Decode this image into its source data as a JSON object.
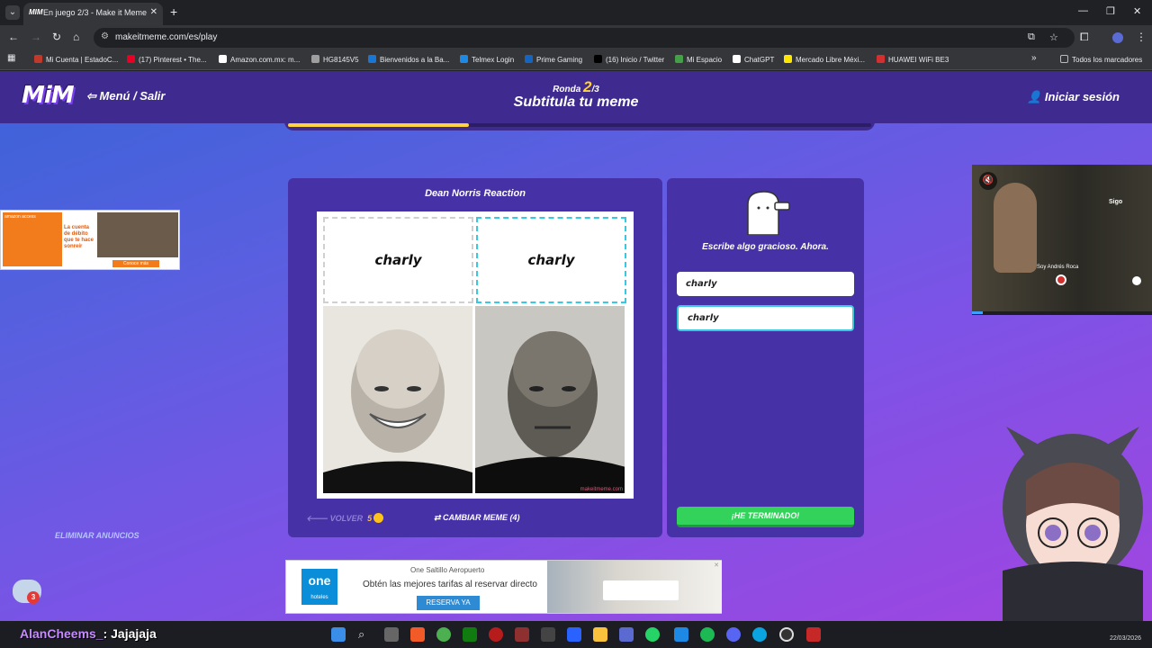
{
  "browser": {
    "tab_title": "En juego 2/3 - Make it Meme",
    "tab_favicon": "MIM",
    "url": "makeitmeme.com/es/play",
    "bookmarks": [
      {
        "label": "Mi Cuenta | EstadoC...",
        "color": "#c0392b"
      },
      {
        "label": "(17) Pinterest • The...",
        "color": "#e60023"
      },
      {
        "label": "Amazon.com.mx: m...",
        "color": "#ffffff"
      },
      {
        "label": "HG8145V5",
        "color": "#9e9e9e"
      },
      {
        "label": "Bienvenidos a la Ba...",
        "color": "#1976d2"
      },
      {
        "label": "Telmex Login",
        "color": "#1e88e5"
      },
      {
        "label": "Prime Gaming",
        "color": "#1565c0"
      },
      {
        "label": "(16) Inicio / Twitter",
        "color": "#000000"
      },
      {
        "label": "Mi Espacio",
        "color": "#43a047"
      },
      {
        "label": "ChatGPT",
        "color": "#ffffff"
      },
      {
        "label": "Mercado Libre Méxi...",
        "color": "#ffe600"
      },
      {
        "label": "HUAWEI WiFi BE3",
        "color": "#d32f2f"
      }
    ],
    "bookmarks_overflow": "»",
    "all_bookmarks": "Todos los marcadores"
  },
  "game": {
    "logo": "MiM",
    "menu_label": "Menú / Salir",
    "round_label": "Ronda",
    "round_current": "2",
    "round_total": "/3",
    "title": "Subtitula tu meme",
    "login_label": "Iniciar sesión",
    "progress": 0.31
  },
  "meme": {
    "template_name": "Dean Norris Reaction",
    "caption_1": "charly",
    "caption_2": "charly",
    "watermark": "makeitmeme.com",
    "back_label": "VOLVER",
    "back_cost": "5",
    "change_label": "CAMBIAR MEME (4)"
  },
  "editor": {
    "prompt": "Escribe algo gracioso. Ahora.",
    "input_1": "charly",
    "input_2": "charly",
    "done_label": "¡HE TERMINADO!"
  },
  "ads": {
    "left_brand": "amazon access",
    "left_text": "La cuenta de débito que te hace sonreír",
    "left_cta": "Conoce más",
    "video_caption": "Soy Andrés Roca",
    "video_brand": "Sigo",
    "remove_ads": "ELIMINAR ANUNCIOS",
    "bottom_logo": "one",
    "bottom_logo_sub": "hoteles",
    "bottom_title": "One Saltillo Aeropuerto",
    "bottom_text": "Obtén las mejores tarifas al reservar directo",
    "bottom_cta": "RESERVA YA"
  },
  "overlay": {
    "chat_user": "AlanCheems_",
    "chat_message": ": Jajajaja",
    "chat_badge": "3",
    "date": "22/03/2026"
  },
  "colors": {
    "accent_yellow": "#ffd23f",
    "panel": "#4731a6",
    "done_green": "#33d35b",
    "focus_cyan": "#36c9e0"
  }
}
